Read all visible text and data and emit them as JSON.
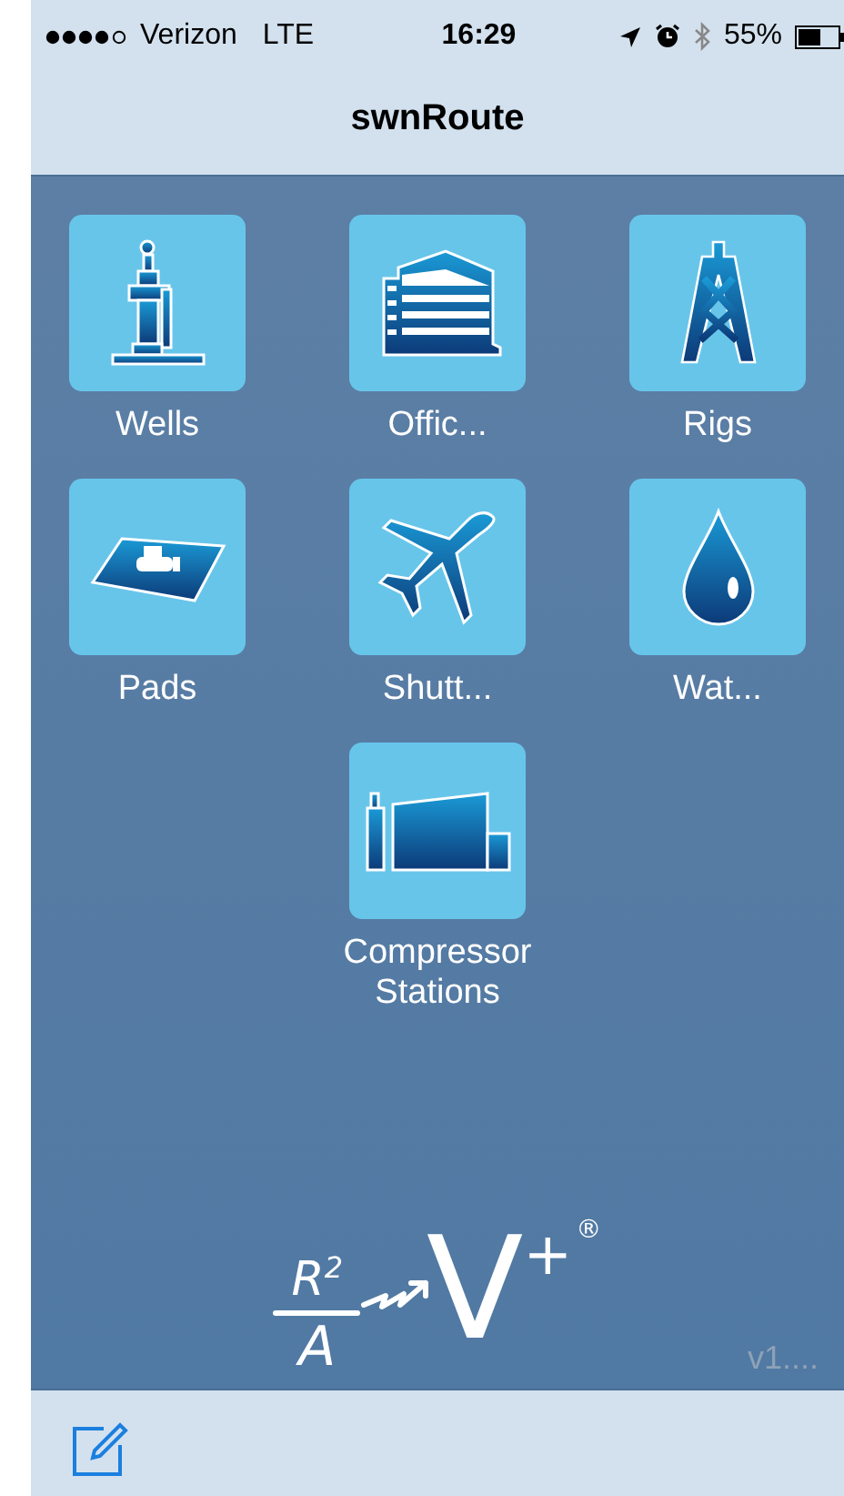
{
  "status_bar": {
    "carrier": "Verizon",
    "network": "LTE",
    "time": "16:29",
    "battery": "55%"
  },
  "nav_bar": {
    "title": "swnRoute"
  },
  "tiles": [
    {
      "kind": "wells",
      "label": "Wells"
    },
    {
      "kind": "office",
      "label": "Offic..."
    },
    {
      "kind": "rig",
      "label": "Rigs"
    },
    {
      "kind": "pad",
      "label": "Pads"
    },
    {
      "kind": "plane",
      "label": "Shutt..."
    },
    {
      "kind": "drop",
      "label": "Wat..."
    },
    {
      "kind": "compressor",
      "label": "Compressor Stations"
    }
  ],
  "logo": {
    "numerator": "R$^{2}$",
    "denominator": "A",
    "main": "V",
    "main_sup": "+",
    "mark": "®"
  },
  "version": "v1....",
  "toolbar": {
    "items": [
      {
        "kind": "compose"
      }
    ]
  }
}
